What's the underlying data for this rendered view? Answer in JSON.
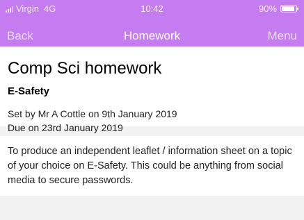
{
  "status_bar": {
    "carrier": "Virgin",
    "network": "4G",
    "time": "10:42",
    "battery_percent": "90%",
    "battery_level": 0.9
  },
  "nav": {
    "back_label": "Back",
    "title": "Homework",
    "menu_label": "Menu"
  },
  "homework": {
    "title": "Comp Sci homework",
    "subject": "E-Safety",
    "set_by": "Set by Mr A Cottle on 9th January 2019",
    "due": "Due on 23rd January 2019",
    "description": "To produce an independent leaflet / information sheet on a topic of your choice on E-Safety. This could be anything from social media to secure passwords."
  },
  "colors": {
    "accent": "#c57cf0",
    "background": "#f2f2f2"
  }
}
